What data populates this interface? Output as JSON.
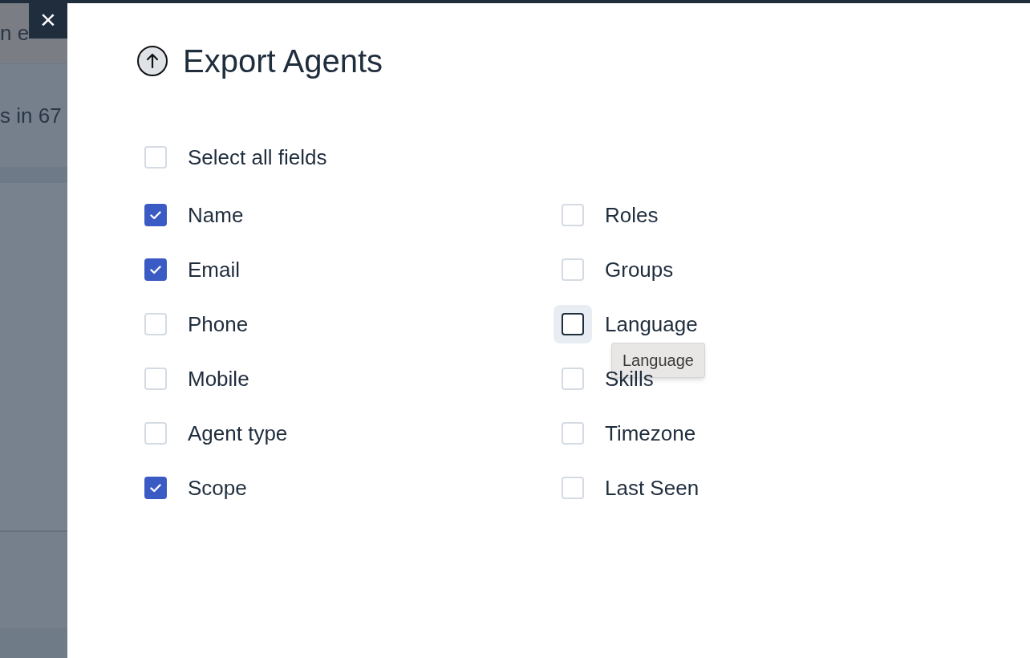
{
  "background_page": {
    "texts": [
      "n e",
      "s in 67"
    ]
  },
  "close_button": {
    "label": "×"
  },
  "dialog": {
    "title": "Export Agents",
    "select_all": {
      "label": "Select all fields",
      "checked": false
    },
    "columns": [
      [
        {
          "label": "Name",
          "checked": true,
          "focused": false
        },
        {
          "label": "Email",
          "checked": true,
          "focused": false
        },
        {
          "label": "Phone",
          "checked": false,
          "focused": false
        },
        {
          "label": "Mobile",
          "checked": false,
          "focused": false
        },
        {
          "label": "Agent type",
          "checked": false,
          "focused": false
        },
        {
          "label": "Scope",
          "checked": true,
          "focused": false
        }
      ],
      [
        {
          "label": "Roles",
          "checked": false,
          "focused": false
        },
        {
          "label": "Groups",
          "checked": false,
          "focused": false
        },
        {
          "label": "Language",
          "checked": false,
          "focused": true,
          "tooltip": "Language"
        },
        {
          "label": "Skills",
          "checked": false,
          "focused": false
        },
        {
          "label": "Timezone",
          "checked": false,
          "focused": false
        },
        {
          "label": "Last Seen",
          "checked": false,
          "focused": false
        }
      ]
    ]
  }
}
